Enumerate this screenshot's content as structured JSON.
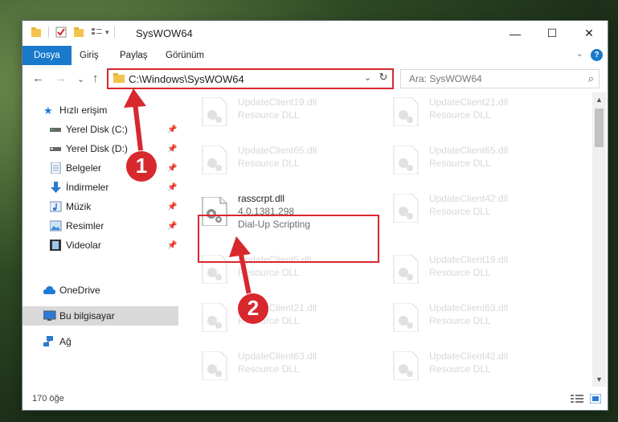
{
  "window": {
    "title": "SysWOW64",
    "minimize": "—",
    "maximize": "☐",
    "close": "✕"
  },
  "ribbon": {
    "tabs": [
      "Dosya",
      "Giriş",
      "Paylaş",
      "Görünüm"
    ],
    "help": "?",
    "collapse": "⌄"
  },
  "nav": {
    "back": "←",
    "forward": "→",
    "recent": "⌄",
    "up": "↑",
    "address": "C:\\Windows\\SysWOW64",
    "address_chevron": "⌄",
    "refresh": "↻",
    "search_placeholder": "Ara: SysWOW64",
    "search_icon": "⌕"
  },
  "sidebar": {
    "items": [
      {
        "label": "Hızlı erişim",
        "icon": "star-icon",
        "pinned": false
      },
      {
        "label": "Yerel Disk (C:)",
        "icon": "drive-icon",
        "pinned": true
      },
      {
        "label": "Yerel Disk (D:)",
        "icon": "drive-icon",
        "pinned": true
      },
      {
        "label": "Belgeler",
        "icon": "documents-icon",
        "pinned": true
      },
      {
        "label": "İndirmeler",
        "icon": "download-icon",
        "pinned": true
      },
      {
        "label": "Müzik",
        "icon": "music-icon",
        "pinned": true
      },
      {
        "label": "Resimler",
        "icon": "pictures-icon",
        "pinned": true
      },
      {
        "label": "Videolar",
        "icon": "videos-icon",
        "pinned": true
      },
      {
        "label": "OneDrive",
        "icon": "cloud-icon",
        "pinned": false
      },
      {
        "label": "Bu bilgisayar",
        "icon": "computer-icon",
        "pinned": false
      },
      {
        "label": "Ağ",
        "icon": "network-icon",
        "pinned": false
      }
    ],
    "pin_glyph": "📌"
  },
  "files": {
    "left": [
      {
        "name": "UpdateClient19.dll",
        "sub": "Resource DLL"
      },
      {
        "name": "UpdateClient65.dll",
        "sub": "Resource DLL"
      },
      {
        "name": "rasscrpt.dll",
        "sub": "4.0.1381.298",
        "desc": "Dial-Up Scripting"
      },
      {
        "name": "UpdateClient5.dll",
        "sub": "Resource DLL"
      },
      {
        "name": "UpdateClient21.dll",
        "sub": "Resource DLL"
      },
      {
        "name": "UpdateClient63.dll",
        "sub": "Resource DLL"
      }
    ],
    "right": [
      {
        "name": "UpdateClient21.dll",
        "sub": "Resource DLL"
      },
      {
        "name": "UpdateClient65.dll",
        "sub": "Resource DLL"
      },
      {
        "name": "UpdateClient42.dll",
        "sub": "Resource DLL"
      },
      {
        "name": "UpdateClient19.dll",
        "sub": "Resource DLL"
      },
      {
        "name": "UpdateClient63.dll",
        "sub": "Resource DLL"
      },
      {
        "name": "UpdateClient42.dll",
        "sub": "Resource DLL"
      }
    ]
  },
  "status": {
    "count": "170 öğe"
  },
  "annotations": {
    "step1": "1",
    "step2": "2",
    "color": "#d7282e"
  }
}
